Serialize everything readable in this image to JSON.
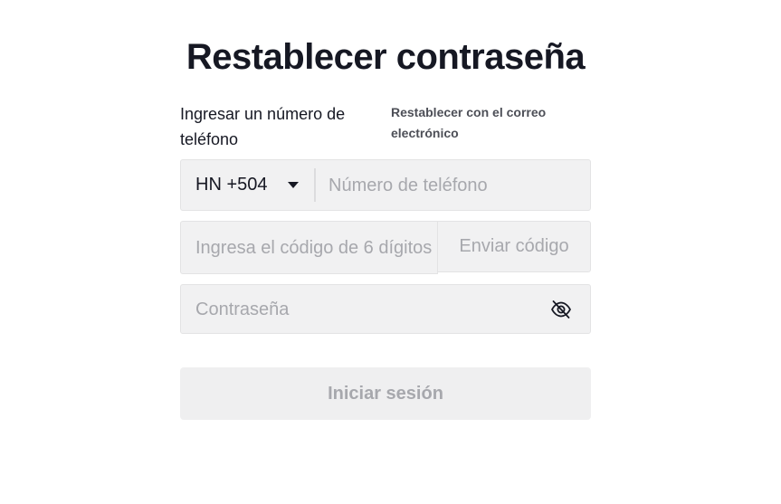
{
  "page": {
    "title": "Restablecer contraseña"
  },
  "tabs": {
    "phone_label": "Ingresar un número de teléfono",
    "email_label": "Restablecer con el correo electrónico"
  },
  "phone": {
    "country_code": "HN +504",
    "placeholder": "Número de teléfono",
    "value": ""
  },
  "code": {
    "placeholder": "Ingresa el código de 6 dígitos",
    "value": "",
    "send_label": "Enviar código"
  },
  "password": {
    "placeholder": "Contraseña",
    "value": "",
    "toggle_icon": "eye-slash-icon"
  },
  "submit": {
    "label": "Iniciar sesión",
    "enabled": false
  },
  "colors": {
    "text": "#161823",
    "field_bg": "#f1f1f2",
    "placeholder": "#a7a8ad",
    "disabled_button_bg": "#efeff0"
  }
}
